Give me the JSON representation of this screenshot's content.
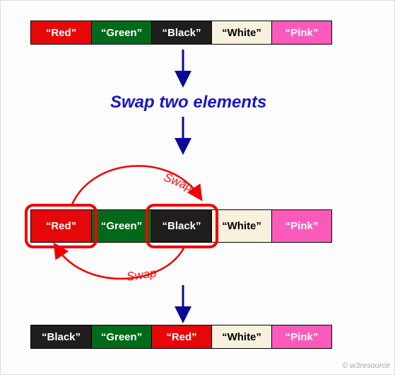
{
  "title": "Swap two elements",
  "swap_label_top": "Swap",
  "swap_label_bottom": "Swap",
  "credit": "© w3resource",
  "colors": {
    "red": {
      "bg": "#e60808",
      "fg": "#ffffff"
    },
    "green": {
      "bg": "#006a1a",
      "fg": "#ffffff"
    },
    "black": {
      "bg": "#1f1d1e",
      "fg": "#ffffff"
    },
    "white": {
      "bg": "#f7f1dd",
      "fg": "#000000"
    },
    "pink": {
      "bg": "#fc5abb",
      "fg": "#ffffff"
    }
  },
  "row1": [
    {
      "label": "“Red”",
      "colorKey": "red"
    },
    {
      "label": "“Green”",
      "colorKey": "green"
    },
    {
      "label": "“Black”",
      "colorKey": "black"
    },
    {
      "label": "“White”",
      "colorKey": "white"
    },
    {
      "label": "“Pink”",
      "colorKey": "pink"
    }
  ],
  "row2": [
    {
      "label": "“Red”",
      "colorKey": "red"
    },
    {
      "label": "“Green”",
      "colorKey": "green"
    },
    {
      "label": "“Black”",
      "colorKey": "black"
    },
    {
      "label": "“White”",
      "colorKey": "white"
    },
    {
      "label": "“Pink”",
      "colorKey": "pink"
    }
  ],
  "row3": [
    {
      "label": "“Black”",
      "colorKey": "black"
    },
    {
      "label": "“Green”",
      "colorKey": "green"
    },
    {
      "label": "“Red”",
      "colorKey": "red"
    },
    {
      "label": "“White”",
      "colorKey": "white"
    },
    {
      "label": "“Pink”",
      "colorKey": "pink"
    }
  ],
  "swap_between": {
    "indexA": 0,
    "indexB": 2
  }
}
